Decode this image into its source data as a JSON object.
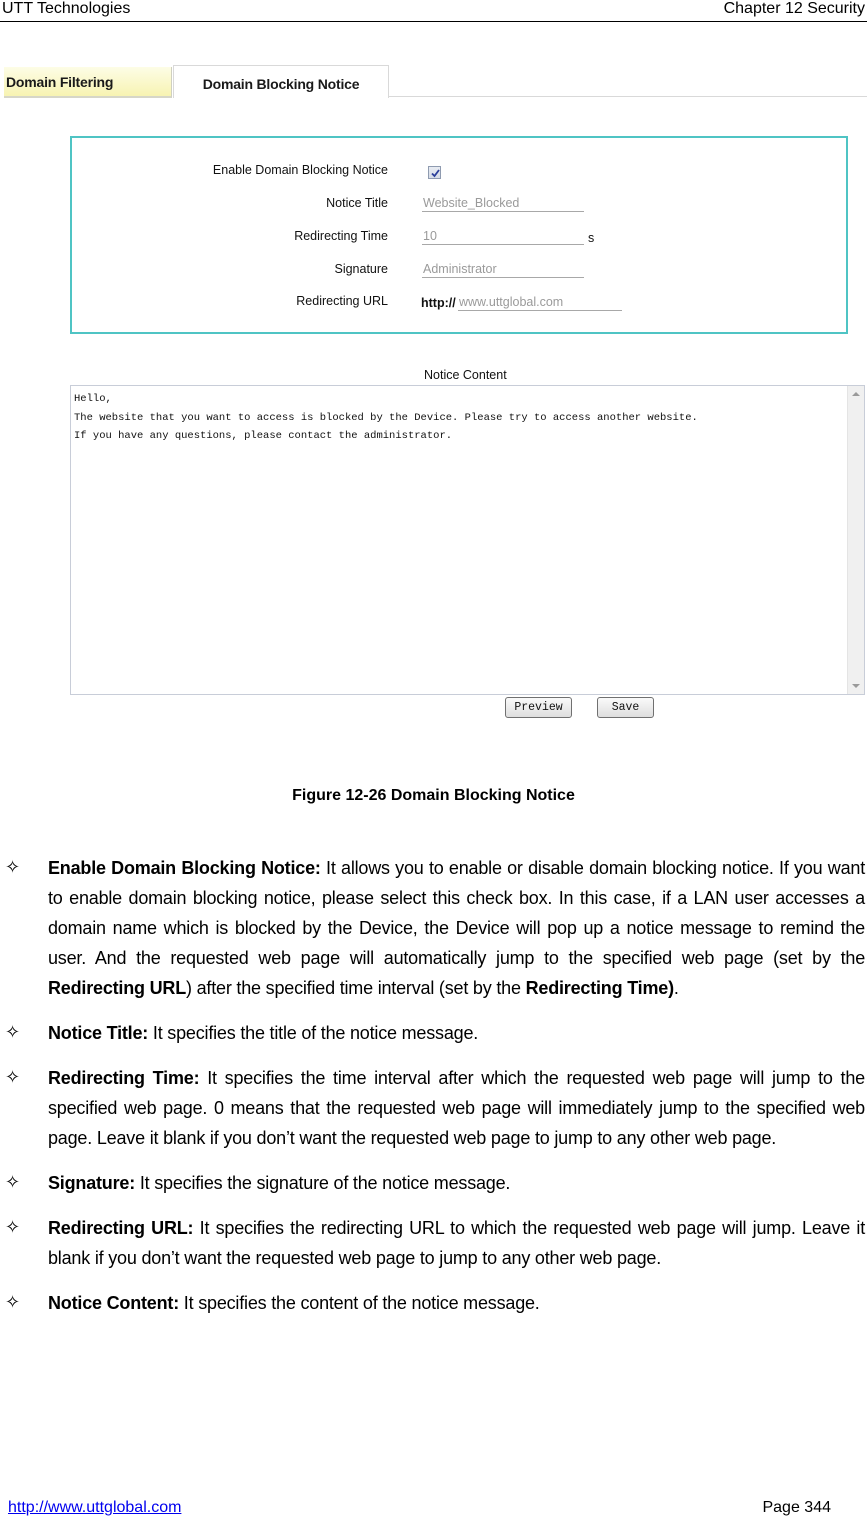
{
  "header": {
    "company": "UTT Technologies",
    "chapter": "Chapter 12 Security"
  },
  "tabs": [
    {
      "label": "Domain Filtering",
      "active": false
    },
    {
      "label": "Domain Blocking Notice",
      "active": true
    }
  ],
  "form": {
    "enable": {
      "label": "Enable Domain Blocking Notice",
      "checked": true
    },
    "notice_title": {
      "label": "Notice Title",
      "value": "Website_Blocked"
    },
    "redirecting_time": {
      "label": "Redirecting Time",
      "value": "10",
      "unit": "s"
    },
    "signature": {
      "label": "Signature",
      "value": "Administrator"
    },
    "redirecting_url": {
      "label": "Redirecting URL",
      "prefix": "http://",
      "value": "www.uttglobal.com"
    }
  },
  "notice_content": {
    "label": "Notice Content",
    "value": "Hello,\nThe website that you want to access is blocked by the Device. Please try to access another website.\nIf you have any questions, please contact the administrator."
  },
  "buttons": {
    "preview": "Preview",
    "save": "Save"
  },
  "caption": "Figure 12-26 Domain Blocking Notice",
  "bullets": [
    {
      "term": "Enable Domain Blocking Notice:",
      "parts": [
        {
          "text": " It allows you to enable or disable domain blocking notice. If you want to enable domain blocking notice, please select this check box. In this case, if a LAN user accesses a domain name which is blocked by the Device, the Device will pop up a notice message to remind the user. And the requested web page will automatically jump to the specified web page (set by the ",
          "bold": false
        },
        {
          "text": "Redirecting URL",
          "bold": true
        },
        {
          "text": ") after the specified time interval (set by the ",
          "bold": false
        },
        {
          "text": "Redirecting Time)",
          "bold": true
        },
        {
          "text": ".",
          "bold": false
        }
      ]
    },
    {
      "term": "Notice Title:",
      "parts": [
        {
          "text": " It specifies the title of the notice message.",
          "bold": false
        }
      ]
    },
    {
      "term": "Redirecting Time:",
      "parts": [
        {
          "text": " It specifies the time interval after which the requested web page will jump to the specified web page. 0 means that the requested web page will immediately jump to the specified web page. Leave it blank if you don’t want the requested web page to jump to any other web page.",
          "bold": false
        }
      ]
    },
    {
      "term": "Signature:",
      "parts": [
        {
          "text": " It specifies the signature of the notice message.",
          "bold": false
        }
      ]
    },
    {
      "term": "Redirecting URL:",
      "parts": [
        {
          "text": " It specifies the redirecting URL to which the requested web page will jump. Leave it blank if you don’t want the requested web page to jump to any other web page.",
          "bold": false
        }
      ]
    },
    {
      "term": "Notice Content:",
      "parts": [
        {
          "text": " It specifies the content of the notice message.",
          "bold": false
        }
      ]
    }
  ],
  "footer": {
    "link": "http://www.uttglobal.com",
    "page": "Page 344"
  },
  "colors": {
    "panel_border": "#4fc4c4",
    "inactive_tab": "#f7f3b2",
    "link": "#0000ee"
  }
}
